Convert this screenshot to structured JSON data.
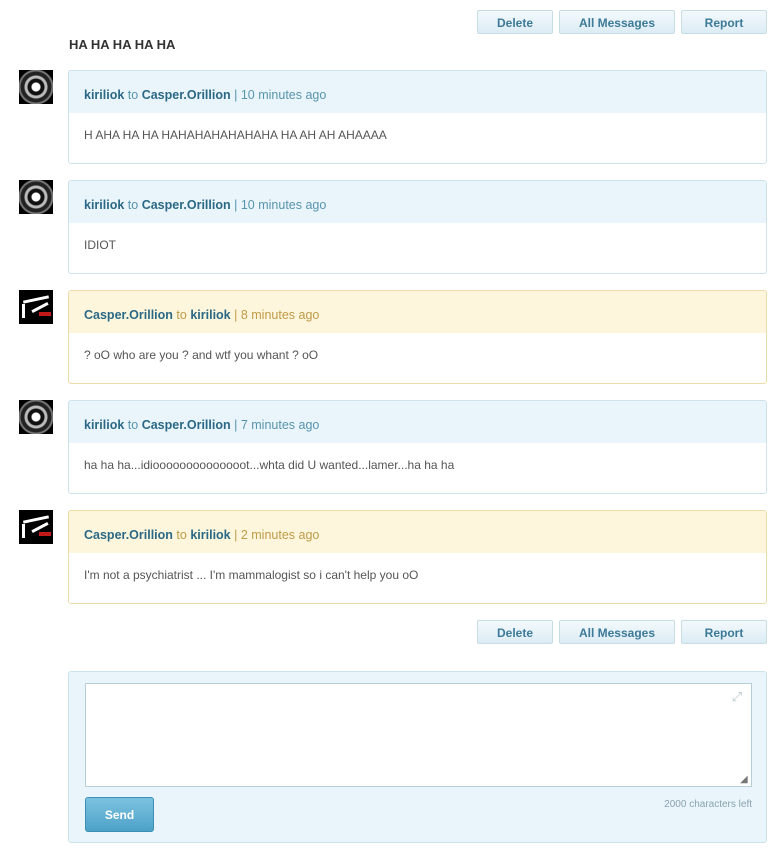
{
  "toolbar": {
    "delete_label": "Delete",
    "all_messages_label": "All Messages",
    "report_label": "Report"
  },
  "subject": "HA HA HA HA HA",
  "messages": [
    {
      "from": "kiriliok",
      "connector": "to",
      "to": "Casper.Orillion",
      "separator": "|",
      "time": "10 minutes ago",
      "text": "H AHA HA HA HAHAHAHAHAHAHA HA AH AH AHAAAA",
      "mine": false
    },
    {
      "from": "kiriliok",
      "connector": "to",
      "to": "Casper.Orillion",
      "separator": "|",
      "time": "10 minutes ago",
      "text": "IDIOT",
      "mine": false
    },
    {
      "from": "Casper.Orillion",
      "connector": "to",
      "to": "kiriliok",
      "separator": "|",
      "time": "8 minutes ago",
      "text": "? oO who are you ? and wtf you whant ? oO",
      "mine": true
    },
    {
      "from": "kiriliok",
      "connector": "to",
      "to": "Casper.Orillion",
      "separator": "|",
      "time": "7 minutes ago",
      "text": "ha ha ha...idioooooooooooooot...whta did U wanted...lamer...ha ha ha",
      "mine": false
    },
    {
      "from": "Casper.Orillion",
      "connector": "to",
      "to": "kiriliok",
      "separator": "|",
      "time": "2 minutes ago",
      "text": "I'm not a psychiatrist ... I'm mammalogist so i can't help you oO",
      "mine": true
    }
  ],
  "compose": {
    "value": "",
    "send_label": "Send",
    "chars_left": "2000 characters left"
  },
  "icons": {
    "expand": "expand-icon",
    "resize": "resize-grip-icon"
  },
  "colors": {
    "bubble_bg": "#e9f5fb",
    "bubble_own_bg": "#fdf6dd",
    "name": "#2b6885",
    "send": "#4da2c8"
  }
}
